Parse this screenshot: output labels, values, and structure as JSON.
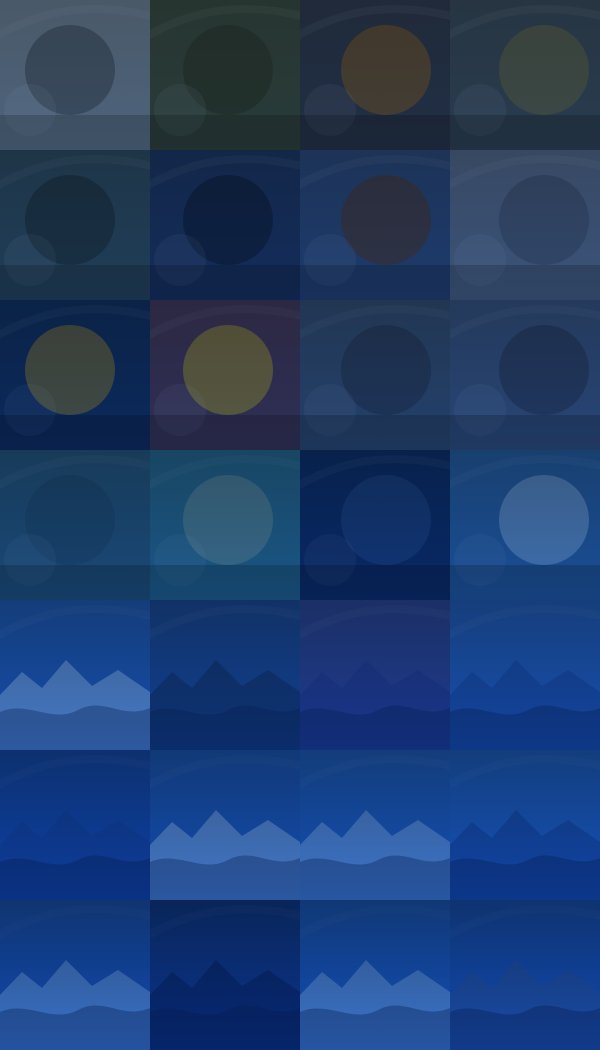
{
  "gallery": {
    "tint_top": "#0d2c57",
    "tint_bottom": "#1f6fd1",
    "columns": 4,
    "rows": 7,
    "tiles": [
      {
        "name": "tile-seagulls-city",
        "icon": "seagulls-city-photo",
        "bg": "#6e7c86",
        "accent": "#3a4650"
      },
      {
        "name": "tile-bear",
        "icon": "bear-photo",
        "bg": "#3a4a3e",
        "accent": "#2a3528"
      },
      {
        "name": "tile-tiger",
        "icon": "tiger-photo",
        "bg": "#2f3a4a",
        "accent": "#8a5d2a"
      },
      {
        "name": "tile-museum-hall",
        "icon": "museum-hall-photo",
        "bg": "#3a4a55",
        "accent": "#6b6a45"
      },
      {
        "name": "tile-vintage-car",
        "icon": "vintage-car-photo",
        "bg": "#315061",
        "accent": "#1c2f3b"
      },
      {
        "name": "tile-coastal-town",
        "icon": "coastal-town-photo",
        "bg": "#1e3a63",
        "accent": "#0d1f38"
      },
      {
        "name": "tile-logs-dog",
        "icon": "logs-dog-photo",
        "bg": "#2e4d77",
        "accent": "#5a3b2e"
      },
      {
        "name": "tile-elephant",
        "icon": "elephant-photo",
        "bg": "#5b6d86",
        "accent": "#3e4e67"
      },
      {
        "name": "tile-steel-wool-spark",
        "icon": "spark-photo",
        "bg": "#123866",
        "accent": "#b08a3a"
      },
      {
        "name": "tile-fruit",
        "icon": "fruit-photo",
        "bg": "#4f4160",
        "accent": "#c9a93a"
      },
      {
        "name": "tile-woman-glasses",
        "icon": "woman-portrait-photo",
        "bg": "#3c5877",
        "accent": "#2a3d56"
      },
      {
        "name": "tile-woman-wind",
        "icon": "woman-back-photo",
        "bg": "#415e83",
        "accent": "#2b3d57"
      },
      {
        "name": "tile-forest-mist",
        "icon": "forest-photo",
        "bg": "#2e6786",
        "accent": "#245574"
      },
      {
        "name": "tile-insect-macro",
        "icon": "insect-photo",
        "bg": "#2f7a96",
        "accent": "#8aa7a0"
      },
      {
        "name": "tile-geometric-structure",
        "icon": "structure-photo",
        "bg": "#0f3a73",
        "accent": "#2c5a92"
      },
      {
        "name": "tile-boy-microphone",
        "icon": "boy-microphone-photo",
        "bg": "#2f6fa8",
        "accent": "#a6c2da"
      },
      {
        "name": "tile-snowy-mountains",
        "icon": "mountains-photo",
        "bg": "#2b74c4",
        "accent": "#d6e7f6"
      },
      {
        "name": "tile-city-aerial",
        "icon": "city-photo",
        "bg": "#245fa5",
        "accent": "#183e6d"
      },
      {
        "name": "tile-purple-horizon",
        "icon": "horizon-photo",
        "bg": "#3c5aa4",
        "accent": "#2b4a9a"
      },
      {
        "name": "tile-blue-hills",
        "icon": "hills-photo",
        "bg": "#2f76c7",
        "accent": "#1f5aa5"
      },
      {
        "name": "tile-starfield",
        "icon": "stars-photo",
        "bg": "#1f66bf",
        "accent": "#1b5aa9"
      },
      {
        "name": "tile-mountain-lake",
        "icon": "lake-photo",
        "bg": "#2b78cc",
        "accent": "#e3eef8"
      },
      {
        "name": "tile-rocket-launch",
        "icon": "rocket-photo",
        "bg": "#2e7fd2",
        "accent": "#cfe2f6"
      },
      {
        "name": "tile-icebergs",
        "icon": "icebergs-photo",
        "bg": "#2f81d6",
        "accent": "#1b5aa9"
      },
      {
        "name": "tile-glacier",
        "icon": "glacier-photo",
        "bg": "#2d7cd0",
        "accent": "#dfeefb"
      },
      {
        "name": "tile-tent-night",
        "icon": "tent-photo",
        "bg": "#1a57a5",
        "accent": "#0d3572"
      },
      {
        "name": "tile-bird-window",
        "icon": "bird-photo",
        "bg": "#2f84d8",
        "accent": "#e6f1fb"
      },
      {
        "name": "tile-rock-arch",
        "icon": "rock-arch-photo",
        "bg": "#2a79cf",
        "accent": "#4f7db5"
      }
    ]
  }
}
